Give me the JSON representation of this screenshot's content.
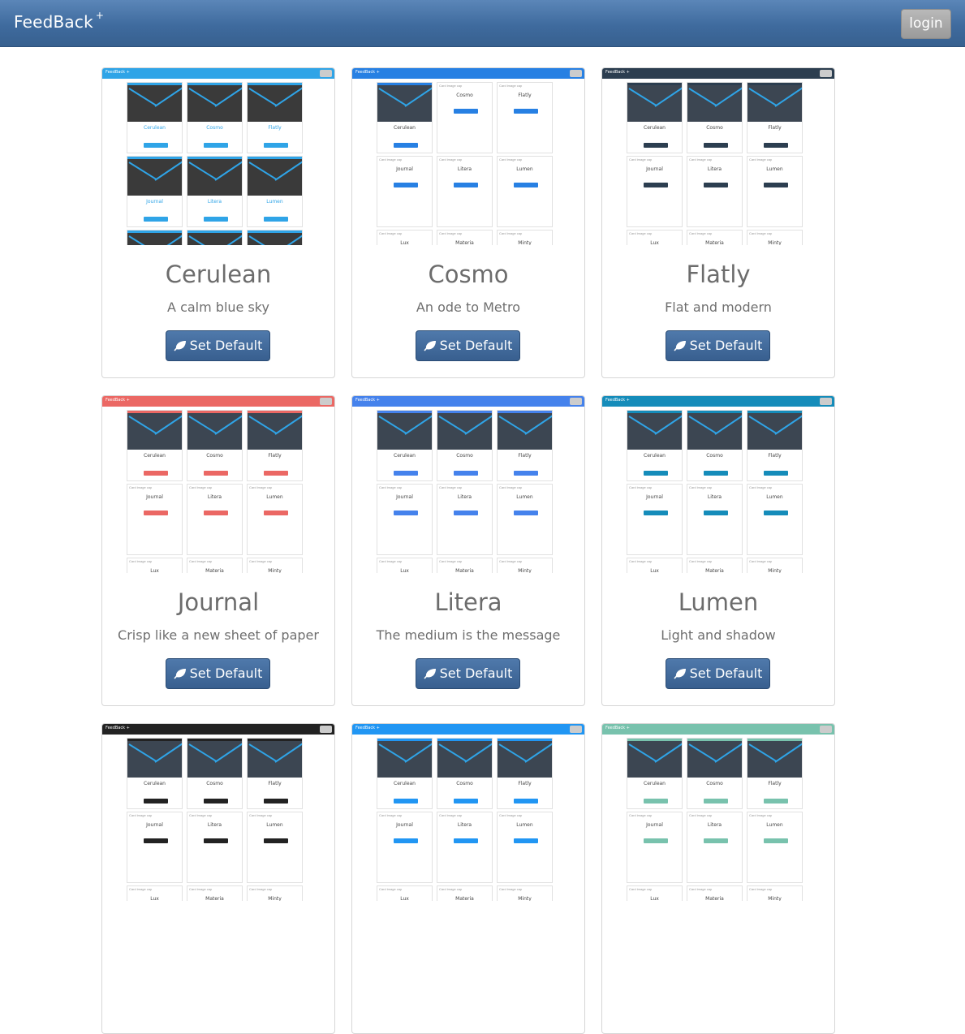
{
  "navbar": {
    "brand": "FeedBack",
    "brand_sup": "+",
    "login_label": "login",
    "color": "#416ea2"
  },
  "button_label": "Set Default",
  "themes": [
    {
      "name": "Cerulean",
      "desc": "A calm blue sky",
      "accent": "#2fa4e7"
    },
    {
      "name": "Cosmo",
      "desc": "An ode to Metro",
      "accent": "#2780e3"
    },
    {
      "name": "Flatly",
      "desc": "Flat and modern",
      "accent": "#2c3e50"
    },
    {
      "name": "Journal",
      "desc": "Crisp like a new sheet of paper",
      "accent": "#eb6864"
    },
    {
      "name": "Litera",
      "desc": "The medium is the message",
      "accent": "#4582ec"
    },
    {
      "name": "Lumen",
      "desc": "Light and shadow",
      "accent": "#158cba"
    },
    {
      "name": "",
      "desc": "",
      "accent": "#222222"
    },
    {
      "name": "",
      "desc": "",
      "accent": "#2196f3"
    },
    {
      "name": "",
      "desc": "",
      "accent": "#78c2ad"
    }
  ],
  "preview_text": {
    "brand": "FeedBack",
    "mini_names": [
      "Cerulean",
      "Cosmo",
      "Flatly",
      "Journal",
      "Litera",
      "Lumen",
      "Lux",
      "Materia",
      "Minty"
    ]
  },
  "icons": {
    "set_default": "leaf-icon"
  }
}
